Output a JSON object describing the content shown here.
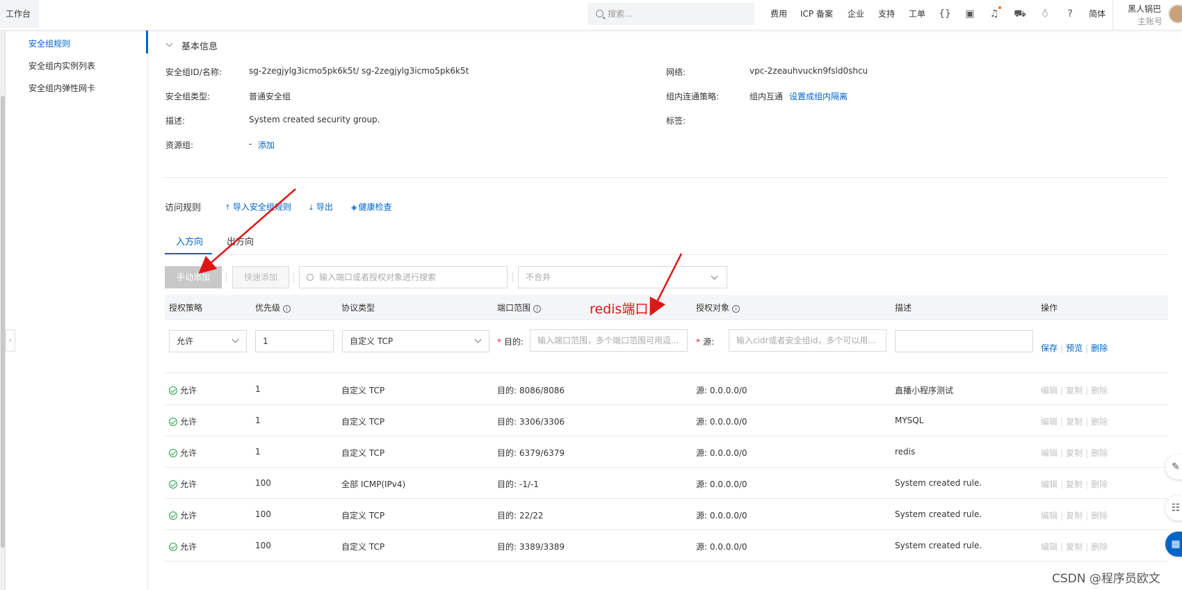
{
  "topbar": {
    "workbench": "工作台",
    "search_placeholder": "搜索...",
    "links": [
      "费用",
      "ICP 备案",
      "企业",
      "支持",
      "工单"
    ],
    "lang": "简体",
    "user_name": "黑人锅巴",
    "user_role": "主账号"
  },
  "sidebar": {
    "items": [
      "安全组规则",
      "安全组内实例列表",
      "安全组内弹性网卡"
    ]
  },
  "basic": {
    "title": "基本信息",
    "id_label": "安全组ID/名称:",
    "id_value": "sg-2zegjylg3icmo5pk6k5t/ sg-2zegjylg3icmo5pk6k5t",
    "type_label": "安全组类型:",
    "type_value": "普通安全组",
    "desc_label": "描述:",
    "desc_value": "System created security group.",
    "rg_label": "资源组:",
    "rg_value": "-",
    "rg_add": "添加",
    "net_label": "网络:",
    "net_value": "vpc-2zeauhvuckn9fsld0shcu",
    "policy_label": "组内连通策略:",
    "policy_value": "组内互通",
    "policy_link": "设置成组内隔离",
    "tag_label": "标签:"
  },
  "rules": {
    "title": "访问规则",
    "import": "导入安全组规则",
    "export": "导出",
    "health": "健康检查",
    "tab_in": "入方向",
    "tab_out": "出方向",
    "btn_manual": "手动添加",
    "btn_quick": "快速添加",
    "search_placeholder": "输入端口或者授权对象进行搜索",
    "merge_placeholder": "不合并",
    "headers": [
      "授权策略",
      "优先级",
      "协议类型",
      "端口范围",
      "授权对象",
      "描述",
      "操作"
    ],
    "edit_row": {
      "policy": "允许",
      "priority": "1",
      "protocol": "自定义 TCP",
      "dest_label": "目的:",
      "dest_placeholder": "输入端口范围，多个端口范围可用逗...",
      "src_label": "源:",
      "src_placeholder": "输入cidr或者安全组id，多个可以用...",
      "ops": [
        "保存",
        "预览",
        "删除"
      ]
    },
    "rows": [
      {
        "policy": "允许",
        "priority": "1",
        "protocol": "自定义 TCP",
        "port": "目的: 8086/8086",
        "source": "源: 0.0.0.0/0",
        "desc": "直播小程序测试"
      },
      {
        "policy": "允许",
        "priority": "1",
        "protocol": "自定义 TCP",
        "port": "目的: 3306/3306",
        "source": "源: 0.0.0.0/0",
        "desc": "MYSQL"
      },
      {
        "policy": "允许",
        "priority": "1",
        "protocol": "自定义 TCP",
        "port": "目的: 6379/6379",
        "source": "源: 0.0.0.0/0",
        "desc": "redis"
      },
      {
        "policy": "允许",
        "priority": "100",
        "protocol": "全部 ICMP(IPv4)",
        "port": "目的: -1/-1",
        "source": "源: 0.0.0.0/0",
        "desc": "System created rule."
      },
      {
        "policy": "允许",
        "priority": "100",
        "protocol": "自定义 TCP",
        "port": "目的: 22/22",
        "source": "源: 0.0.0.0/0",
        "desc": "System created rule."
      },
      {
        "policy": "允许",
        "priority": "100",
        "protocol": "自定义 TCP",
        "port": "目的: 3389/3389",
        "source": "源: 0.0.0.0/0",
        "desc": "System created rule."
      }
    ],
    "row_ops": [
      "编辑",
      "复制",
      "删除"
    ]
  },
  "annotation": "redis端口",
  "watermark": "CSDN @程序员欧文",
  "colors": {
    "accent": "#0064c8",
    "annotation": "#e01515",
    "ok": "#24a148"
  }
}
